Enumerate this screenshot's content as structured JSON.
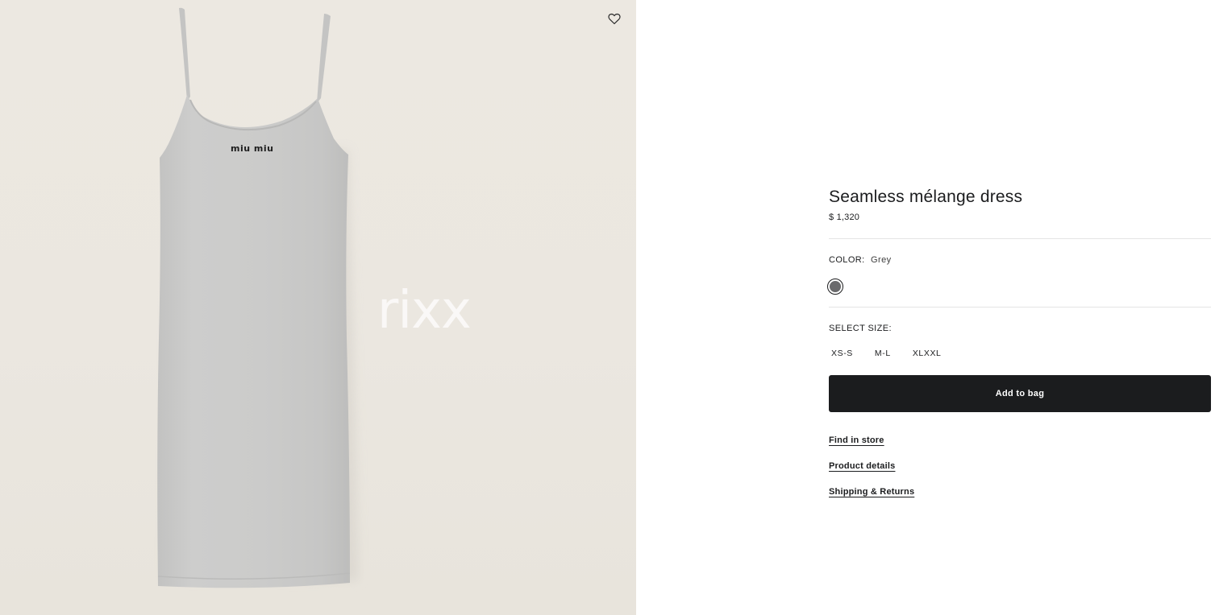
{
  "product": {
    "title": "Seamless mélange dress",
    "price": "$ 1,320",
    "image_brand_print": "miu miu",
    "watermark": "rixx"
  },
  "color": {
    "label": "COLOR:",
    "value": "Grey",
    "swatch_hex": "#6a6a6c"
  },
  "size": {
    "label": "SELECT SIZE:",
    "options": [
      "XS-S",
      "M-L",
      "XLXXL"
    ]
  },
  "actions": {
    "add_to_bag": "Add to bag"
  },
  "links": {
    "find_in_store": "Find in store",
    "product_details": "Product details",
    "shipping_returns": "Shipping & Returns"
  },
  "icons": {
    "wishlist": "heart-outline-icon"
  },
  "colors": {
    "background_image": "#ebe7e0",
    "dress": "#c9c9c8",
    "button": "#1b1c1e"
  }
}
